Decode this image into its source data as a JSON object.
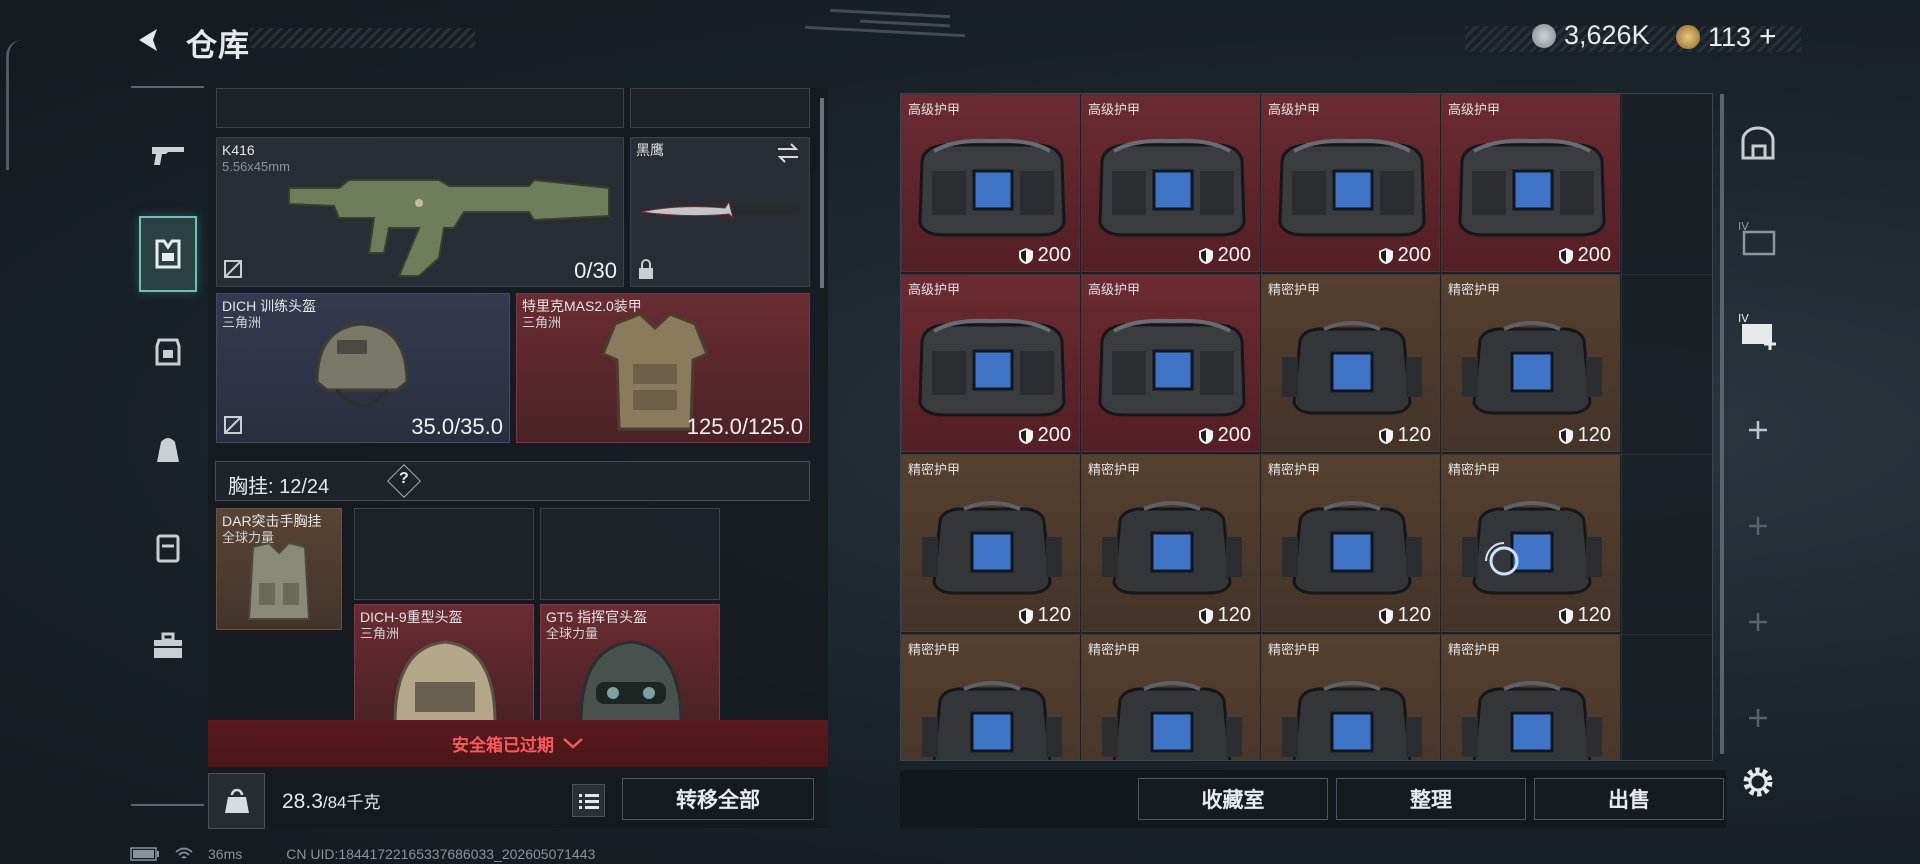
{
  "header": {
    "title": "仓库",
    "currency_1": "3,626K",
    "currency_2": "113",
    "currency_2_add": "+"
  },
  "sidebar": {
    "items": [
      {
        "icon": "gun-icon"
      },
      {
        "icon": "vest-icon",
        "active": true
      },
      {
        "icon": "armor-icon"
      },
      {
        "icon": "backpack-icon"
      },
      {
        "icon": "rig-icon"
      },
      {
        "icon": "toolbox-icon"
      }
    ]
  },
  "loadout": {
    "weapon": {
      "name": "K416",
      "caliber": "5.56x45mm",
      "ammo": "0/30"
    },
    "melee": {
      "name": "黑鹰"
    },
    "helmet": {
      "name": "DICH 训练头盔",
      "faction": "三角洲",
      "durability": "35.0/35.0"
    },
    "armor": {
      "name": "特里克MAS2.0装甲",
      "faction": "三角洲",
      "durability": "125.0/125.0"
    },
    "rig_label": "胸挂:",
    "rig_capacity": "12/24",
    "rig_help": "?",
    "rig_item": {
      "name": "DAR突击手胸挂",
      "faction": "全球力量"
    },
    "helmet_2": {
      "name": "DICH-9重型头盔",
      "faction": "三角洲"
    },
    "helmet_3": {
      "name": "GT5 指挥官头盔",
      "faction": "全球力量"
    },
    "expired_text": "安全箱已过期",
    "weight": "28.3",
    "weight_max": "/84千克",
    "transfer_all": "转移全部"
  },
  "stash": {
    "items": [
      {
        "name": "高级护甲",
        "value": "200",
        "tier": "red"
      },
      {
        "name": "高级护甲",
        "value": "200",
        "tier": "red"
      },
      {
        "name": "高级护甲",
        "value": "200",
        "tier": "red"
      },
      {
        "name": "高级护甲",
        "value": "200",
        "tier": "red"
      },
      {
        "name": "高级护甲",
        "value": "200",
        "tier": "red"
      },
      {
        "name": "高级护甲",
        "value": "200",
        "tier": "red"
      },
      {
        "name": "精密护甲",
        "value": "120",
        "tier": "brown"
      },
      {
        "name": "精密护甲",
        "value": "120",
        "tier": "brown"
      },
      {
        "name": "精密护甲",
        "value": "120",
        "tier": "brown"
      },
      {
        "name": "精密护甲",
        "value": "120",
        "tier": "brown"
      },
      {
        "name": "精密护甲",
        "value": "120",
        "tier": "brown"
      },
      {
        "name": "精密护甲",
        "value": "120",
        "tier": "brown"
      },
      {
        "name": "精密护甲",
        "value": "",
        "tier": "brown"
      },
      {
        "name": "精密护甲",
        "value": "",
        "tier": "brown"
      },
      {
        "name": "精密护甲",
        "value": "",
        "tier": "brown"
      },
      {
        "name": "精密护甲",
        "value": "",
        "tier": "brown"
      }
    ],
    "collection_room": "收藏室",
    "sort": "整理",
    "sell": "出售"
  },
  "status": {
    "ping": "36ms",
    "uid": "CN UID:18441722165337686033_202605071443"
  },
  "colors": {
    "accent_teal": "#6bc3b8",
    "tier_red": "#6b2b32",
    "tier_brown": "#56402f",
    "expired_red": "#ff5a5a"
  }
}
